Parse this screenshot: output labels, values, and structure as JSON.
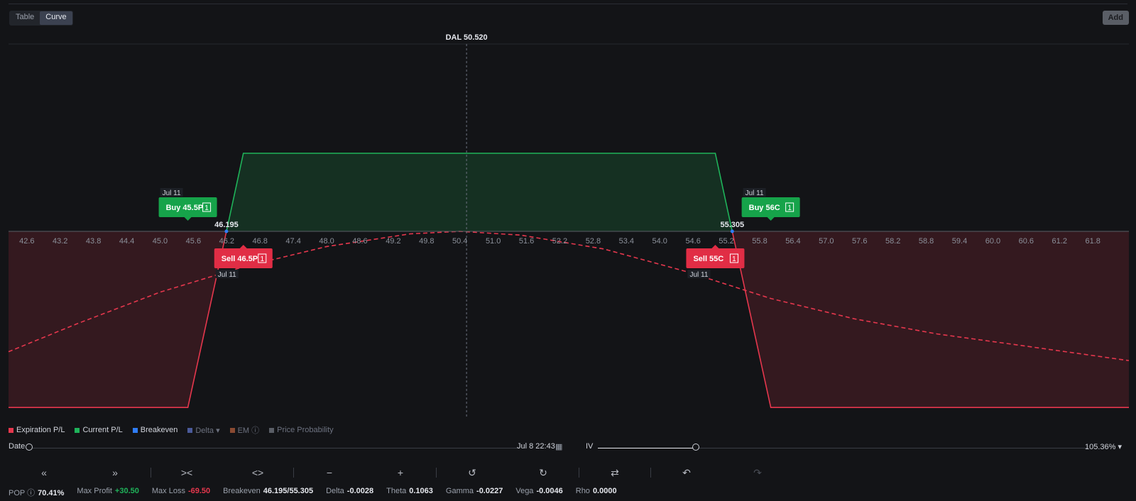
{
  "view_toggle": {
    "table_label": "Table",
    "curve_label": "Curve",
    "active": "Curve"
  },
  "add_label": "Add",
  "chart_data": {
    "type": "area",
    "x_ticks": [
      "42.6",
      "43.2",
      "43.8",
      "44.4",
      "45.0",
      "45.6",
      "46.2",
      "46.8",
      "47.4",
      "48.0",
      "48.6",
      "49.2",
      "49.8",
      "50.4",
      "51.0",
      "51.6",
      "52.2",
      "52.8",
      "53.4",
      "54.0",
      "54.6",
      "55.2",
      "55.8",
      "56.4",
      "57.0",
      "57.6",
      "58.2",
      "58.8",
      "59.4",
      "60.0",
      "60.6",
      "61.2",
      "61.8"
    ],
    "xlim": [
      42.27,
      62.45
    ],
    "ylim": [
      -70,
      30.5
    ],
    "current_price_label": "DAL 50.520",
    "current_price": 50.52,
    "series": [
      {
        "name": "Expiration P/L",
        "x": [
          42.27,
          45.5,
          46.5,
          55.0,
          56.0,
          62.45
        ],
        "y": [
          -69.5,
          -69.5,
          30.5,
          30.5,
          -69.5,
          -69.5
        ]
      },
      {
        "name": "Current P/L",
        "x": [
          42.27,
          43.5,
          45.0,
          46.5,
          48.0,
          49.5,
          50.4,
          51.5,
          53.0,
          54.5,
          56.0,
          57.5,
          59.0,
          60.5,
          62.45
        ],
        "y": [
          -47.5,
          -36.5,
          -24,
          -14,
          -6,
          -1,
          0,
          -1.5,
          -7,
          -16,
          -26.5,
          -34.5,
          -40.5,
          -45,
          -51
        ]
      }
    ],
    "breakevens": [
      {
        "value": 46.195,
        "label": "46.195"
      },
      {
        "value": 55.305,
        "label": "55.305"
      }
    ],
    "legs": [
      {
        "action": "Buy",
        "label": "Buy 45.5P",
        "qty": "1",
        "date": "Jul 11",
        "strike": 45.5,
        "side": "up"
      },
      {
        "action": "Sell",
        "label": "Sell 46.5P",
        "qty": "1",
        "date": "Jul 11",
        "strike": 46.5,
        "side": "down"
      },
      {
        "action": "Sell",
        "label": "Sell 55C",
        "qty": "1",
        "date": "Jul 11",
        "strike": 55.0,
        "side": "down"
      },
      {
        "action": "Buy",
        "label": "Buy 56C",
        "qty": "1",
        "date": "Jul 11",
        "strike": 56.0,
        "side": "up"
      }
    ],
    "colors": {
      "profit": "#1fb35a",
      "loss": "#e5374d",
      "breakeven": "#2f7df6"
    }
  },
  "legend": [
    {
      "label": "Expiration P/L",
      "color": "#e5374d",
      "dim": false
    },
    {
      "label": "Current P/L",
      "color": "#1fb35a",
      "dim": false
    },
    {
      "label": "Breakeven",
      "color": "#2f7df6",
      "dim": false
    },
    {
      "label": "Delta ▾",
      "color": "#4a5a9a",
      "dim": true
    },
    {
      "label": "EM ⓘ",
      "color": "#8a4a32",
      "dim": true
    },
    {
      "label": "Price Probability",
      "color": "#5a5e66",
      "dim": true
    }
  ],
  "date_row": {
    "label": "Date",
    "value": "Jul 8 22:43",
    "iv_label": "IV",
    "iv_value": "105.36% ▾",
    "iv_level": 0.2
  },
  "toolbar_icons": [
    "double-left-icon",
    "double-right-icon",
    "collapse-icon",
    "expand-icon",
    "zoom-out-icon",
    "zoom-in-icon",
    "history-back-icon",
    "history-forward-icon",
    "swap-icon",
    "undo-icon",
    "redo-icon"
  ],
  "stats": [
    {
      "label": "POP ⓘ",
      "value": "70.41%",
      "tone": ""
    },
    {
      "label": "Max Profit",
      "value": "+30.50",
      "tone": "pos"
    },
    {
      "label": "Max Loss",
      "value": "-69.50",
      "tone": "neg"
    },
    {
      "label": "Breakeven",
      "value": "46.195/55.305",
      "tone": ""
    },
    {
      "label": "Delta",
      "value": "-0.0028",
      "tone": ""
    },
    {
      "label": "Theta",
      "value": "0.1063",
      "tone": ""
    },
    {
      "label": "Gamma",
      "value": "-0.0227",
      "tone": ""
    },
    {
      "label": "Vega",
      "value": "-0.0046",
      "tone": ""
    },
    {
      "label": "Rho",
      "value": "0.0000",
      "tone": ""
    }
  ]
}
